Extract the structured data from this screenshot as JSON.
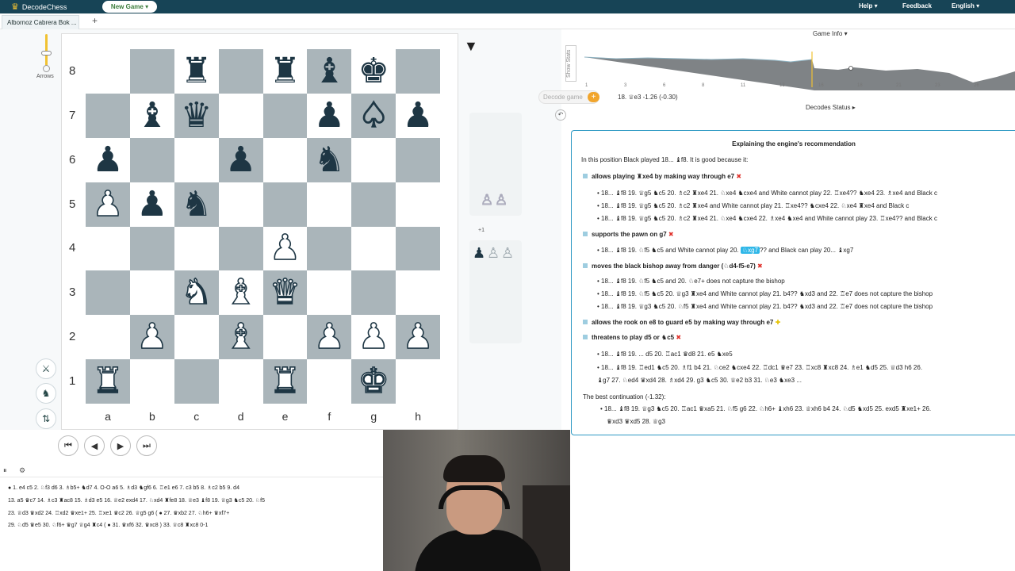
{
  "topbar": {
    "app_name": "DecodeChess",
    "new_game_label": "New Game",
    "help_label": "Help",
    "feedback_label": "Feedback",
    "language_label": "English"
  },
  "tabs": [
    {
      "label": "Albornoz Cabrera Bok ..."
    }
  ],
  "left_tools": {
    "arrows_label": "Arrows"
  },
  "board": {
    "ranks": [
      "8",
      "7",
      "6",
      "5",
      "4",
      "3",
      "2",
      "1"
    ],
    "files": [
      "a",
      "b",
      "c",
      "d",
      "e",
      "f",
      "g",
      "h"
    ],
    "position": [
      [
        "",
        "",
        "♜b",
        "",
        "♜b",
        "♝b",
        "♚b",
        ""
      ],
      [
        "",
        "♝b",
        "♛b",
        "",
        "",
        "♟b",
        "♞w",
        "♟b"
      ],
      [
        "♟b",
        "",
        "",
        "♟b",
        "",
        "♞b",
        "",
        ""
      ],
      [
        "♙w",
        "♟b",
        "♞b",
        "",
        "",
        "",
        "",
        ""
      ],
      [
        "",
        "",
        "",
        "",
        "♙w",
        "",
        "",
        ""
      ],
      [
        "",
        "",
        "♘w",
        "♗w",
        "♕w",
        "",
        "",
        ""
      ],
      [
        "",
        "♙w",
        "",
        "♗w",
        "",
        "♙w",
        "♙w",
        "♙w"
      ],
      [
        "♖w",
        "",
        "",
        "",
        "♖w",
        "",
        "♔w",
        ""
      ]
    ]
  },
  "captured": {
    "top": [
      "♙",
      "♙"
    ],
    "bottom_label": "+1",
    "bottom": [
      "♟",
      "♙",
      "♙"
    ]
  },
  "nav": {
    "first": "⏮",
    "prev": "◀",
    "next": "▶",
    "last": "⏭"
  },
  "game_info": {
    "label": "Game Info",
    "show_stats_label": "Show Stats",
    "graph_x_labels": [
      "1",
      "3",
      "6",
      "8",
      "11",
      "13",
      "16",
      "18",
      "21",
      "23",
      "26"
    ],
    "decode_game_label": "Decode game",
    "eval_line": "18. ♕e3  -1.26  (-0.30)",
    "decodes_status_label": "Decodes Status"
  },
  "explanation": {
    "title": "Explaining the engine's recommendation",
    "intro": "In this position Black played 18... ♝f8. It is good because it:",
    "sections": [
      {
        "heading": "allows playing ♜xe4 by making way through e7",
        "mark": "✖"
      },
      {
        "heading": "supports the pawn on g7",
        "mark": "✖"
      },
      {
        "heading": "moves the black bishop away from danger (♘d4-f5-e7)",
        "mark": "✖"
      },
      {
        "heading": "allows the rook on e8 to guard e5 by making way through e7",
        "mark": "✚"
      },
      {
        "heading": "threatens to play  d5  or  ♞c5",
        "mark": "✖"
      }
    ],
    "lines": [
      "18... ♝f8 19. ♕g5 ♞c5 20. ♗c2 ♜xe4 21. ♘xe4 ♞cxe4 and White cannot play 22. ♖xe4?? ♞xe4 23. ♗xe4 and Black c",
      "18... ♝f8 19. ♕g5 ♞c5 20. ♗c2 ♜xe4 and White cannot play 21. ♖xe4?? ♞cxe4 22. ♘xe4 ♜xe4 and Black c",
      "18... ♝f8 19. ♕g5 ♞c5 20. ♗c2 ♜xe4 21. ♘xe4 ♞cxe4 22. ♗xe4 ♞xe4 and White cannot play 23. ♖xe4?? and Black c",
      "18... ♝f8 19. ♘f5 ♞c5 and White cannot play 20.",
      "♘xg7",
      "?? and Black can play 20... ♝xg7",
      "18... ♝f8 19. ♘f5 ♞c5 and 20. ♘e7+  does not capture the bishop",
      "18... ♝f8 19. ♘f5 ♞c5 20. ♕g3 ♜xe4 and White cannot play 21. b4?? ♞xd3 and 22. ♖e7  does not capture the bishop",
      "18... ♝f8 19. ♕g3 ♞c5 20. ♘f5 ♜xe4 and White cannot play 21. b4?? ♞xd3 and 22. ♖e7  does not capture the bishop",
      "18... ♝f8 19. ... d5 20. ♖ac1 ♛d8 21. e5 ♞xe5",
      "18... ♝f8 19. ♖ed1 ♞c5 20. ♗f1 b4 21. ♘ce2 ♞cxe4 22. ♖dc1 ♛e7 23. ♖xc8 ♜xc8 24. ♗e1 ♞d5 25. ♕d3 h6 26.",
      "♝g7 27. ♘ed4 ♛xd4 28. ♗xd4 29. g3 ♞c5 30. ♕e2 b3 31. ♘e3 ♞xe3 ..."
    ],
    "best_label": "The best continuation (-1.32):",
    "best_lines": [
      "18... ♝f8 19. ♕g3 ♞c5 20. ♖ac1 ♛xa5 21. ♘f5 g6 22. ♘h6+ ♝xh6 23. ♕xh6 b4 24. ♘d5 ♞xd5 25. exd5 ♜xe1+ 26.",
      "♛xd3 ♛xd5 28. ♕g3"
    ]
  },
  "movelist": {
    "rows": [
      "● 1. e4 c5 2. ♘f3 d6 3. ♗b5+ ♞d7 4. O-O a6 5. ♗d3 ♞gf6 6. ♖e1 e6 7. c3 b5 8. ♗c2 b5 9. d4",
      "13. a5 ♛c7 14. ♗c3 ♜ac8 15. ♗d3 e5 16. ♕e2 exd4 17. ♘xd4 ♜fe8 18. ♕e3 ♝f8 19. ♕g3 ♞c5 20. ♘f5",
      "23. ♕d3 ♛xd2 24. ♖xd2 ♛xe1+ 25. ♖xe1 ♛c2 26. ♕g5 g6 ( ● 27. ♛xb2 27. ♘h6+ ♛xf7+",
      "29. ♘d5 ♛e5 30. ♘f6+ ♛g7 ♕g4 ♜c4 ( ● 31. ♛xf6 32. ♛xc8 ) 33. ♕c8 ♜xc8 0-1"
    ]
  }
}
